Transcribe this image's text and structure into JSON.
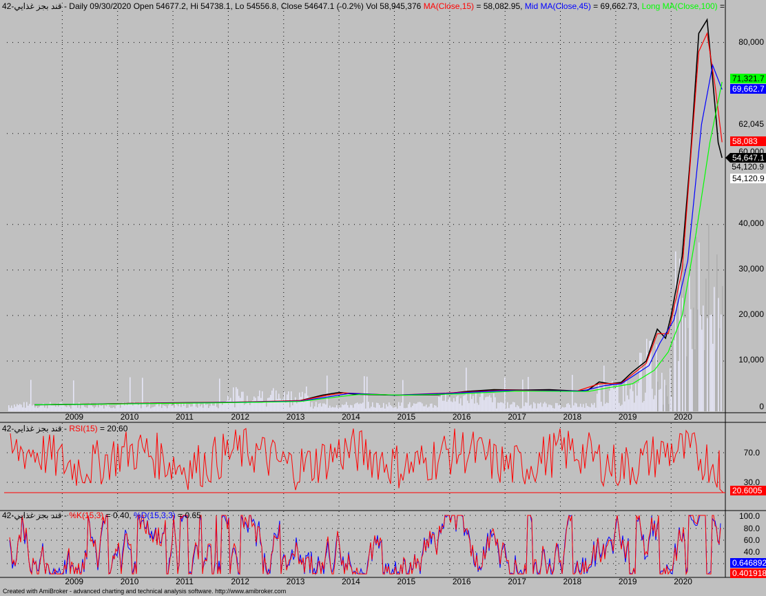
{
  "footer": "Created with AmiBroker - advanced charting and technical analysis software. http://www.amibroker.com",
  "main_pane": {
    "header_prefix": "42-قند بجز غذايي - Daily 09/30/2020 Open 54677.2, Hi 54738.1, Lo 54556.8, Close 54647.1 (-0.2%) Vol 58,945,376",
    "ma15": {
      "label": "MA(Close,15)",
      "value": "= 58,082.95,",
      "color": "#ff0000"
    },
    "ma45": {
      "label": "Mid MA(Close,45)",
      "value": "= 69,662.73,",
      "color": "#0000ff"
    },
    "ma100": {
      "label": "Long MA(Close,100)",
      "value": "=",
      "color": "#00ff00"
    },
    "y_ticks": [
      "80,000",
      "60,000",
      "40,000",
      "30,000",
      "20,000",
      "10,000",
      "0"
    ],
    "extra_labels": [
      "62,045",
      "54,120.9"
    ],
    "markers": [
      {
        "text": "71,321.7",
        "bg": "#00ff00",
        "fg": "#000000"
      },
      {
        "text": "69,662.7",
        "bg": "#0000ff",
        "fg": "#ffffff"
      },
      {
        "text": "58,083",
        "bg": "#ff0000",
        "fg": "#ffffff"
      },
      {
        "text": "54,647.1",
        "bg": "#000000",
        "fg": "#ffffff"
      },
      {
        "text": "54,120.9",
        "bg": "#ffffff",
        "fg": "#000000"
      }
    ]
  },
  "rsi_pane": {
    "header_prefix": "42-قند بجز غذايي -",
    "label": "RSI(15)",
    "value": "= 20.60",
    "color": "#ff0000",
    "y_ticks": [
      "70.0",
      "30.0"
    ],
    "marker": {
      "text": "20.6005",
      "bg": "#ff0000",
      "fg": "#ffffff"
    }
  },
  "stoch_pane": {
    "header_prefix": "42-قند بجز غذايي -",
    "k_label": "%K(15,3)",
    "k_value": "= 0.40,",
    "d_label": "%D(15,3,3)",
    "d_value": "= 0.65",
    "k_color": "#ff0000",
    "d_color": "#0000ff",
    "y_ticks": [
      "100.0",
      "80.0",
      "60.0",
      "40.0",
      "20.0"
    ],
    "markers": [
      {
        "text": "0.646892",
        "bg": "#0000ff",
        "fg": "#ffffff"
      },
      {
        "text": "0.401918",
        "bg": "#ff0000",
        "fg": "#ffffff"
      }
    ]
  },
  "years": [
    "2009",
    "2010",
    "2011",
    "2012",
    "2013",
    "2014",
    "2015",
    "2016",
    "2017",
    "2018",
    "2019",
    "2020"
  ],
  "chart_data": {
    "type": "line",
    "title": "42-قند بجز غذايي - Daily",
    "x": [
      "2009",
      "2010",
      "2011",
      "2012",
      "2013",
      "2014",
      "2015",
      "2016",
      "2017",
      "2018",
      "2019",
      "2020"
    ],
    "ylim": [
      0,
      90000
    ],
    "series": [
      {
        "name": "Close",
        "color": "#000000",
        "points": [
          [
            2008.5,
            400
          ],
          [
            2009.5,
            500
          ],
          [
            2010.3,
            700
          ],
          [
            2011.0,
            800
          ],
          [
            2011.8,
            900
          ],
          [
            2012.6,
            1000
          ],
          [
            2013.3,
            1300
          ],
          [
            2013.7,
            2500
          ],
          [
            2014.0,
            3100
          ],
          [
            2014.3,
            2700
          ],
          [
            2015.0,
            2500
          ],
          [
            2015.8,
            2600
          ],
          [
            2016.3,
            3300
          ],
          [
            2016.8,
            3700
          ],
          [
            2017.3,
            3600
          ],
          [
            2017.8,
            3700
          ],
          [
            2018.3,
            3400
          ],
          [
            2018.5,
            3600
          ],
          [
            2018.7,
            5400
          ],
          [
            2018.9,
            5000
          ],
          [
            2019.1,
            5300
          ],
          [
            2019.3,
            7600
          ],
          [
            2019.55,
            10000
          ],
          [
            2019.75,
            17000
          ],
          [
            2019.9,
            15000
          ],
          [
            2020.0,
            20000
          ],
          [
            2020.2,
            33000
          ],
          [
            2020.35,
            55000
          ],
          [
            2020.5,
            82000
          ],
          [
            2020.65,
            85000
          ],
          [
            2020.75,
            72000
          ],
          [
            2020.85,
            58000
          ],
          [
            2020.92,
            54647
          ]
        ]
      },
      {
        "name": "MA(Close,15)",
        "color": "#ff0000",
        "points": [
          [
            2008.5,
            400
          ],
          [
            2010.3,
            700
          ],
          [
            2011.8,
            900
          ],
          [
            2013.3,
            1300
          ],
          [
            2013.8,
            2500
          ],
          [
            2014.1,
            3000
          ],
          [
            2015.0,
            2500
          ],
          [
            2016.0,
            3000
          ],
          [
            2017.0,
            3600
          ],
          [
            2018.3,
            3400
          ],
          [
            2018.7,
            5000
          ],
          [
            2019.1,
            5100
          ],
          [
            2019.55,
            9500
          ],
          [
            2019.75,
            16000
          ],
          [
            2019.95,
            16000
          ],
          [
            2020.2,
            30000
          ],
          [
            2020.5,
            78000
          ],
          [
            2020.65,
            82000
          ],
          [
            2020.8,
            70000
          ],
          [
            2020.92,
            58083
          ]
        ]
      },
      {
        "name": "Mid MA(Close,45)",
        "color": "#0000ff",
        "points": [
          [
            2008.5,
            400
          ],
          [
            2010.3,
            650
          ],
          [
            2011.8,
            850
          ],
          [
            2013.3,
            1200
          ],
          [
            2013.9,
            2300
          ],
          [
            2014.2,
            2900
          ],
          [
            2015.0,
            2500
          ],
          [
            2016.0,
            2900
          ],
          [
            2017.0,
            3500
          ],
          [
            2018.4,
            3400
          ],
          [
            2018.8,
            4600
          ],
          [
            2019.1,
            5000
          ],
          [
            2019.6,
            9000
          ],
          [
            2019.8,
            14000
          ],
          [
            2020.05,
            19000
          ],
          [
            2020.3,
            32000
          ],
          [
            2020.55,
            62000
          ],
          [
            2020.75,
            75000
          ],
          [
            2020.92,
            69663
          ]
        ]
      },
      {
        "name": "Long MA(Close,100)",
        "color": "#00ff00",
        "points": [
          [
            2008.5,
            400
          ],
          [
            2010.3,
            600
          ],
          [
            2011.8,
            800
          ],
          [
            2013.3,
            1100
          ],
          [
            2014.1,
            2300
          ],
          [
            2014.4,
            2700
          ],
          [
            2015.2,
            2500
          ],
          [
            2016.2,
            2800
          ],
          [
            2017.2,
            3400
          ],
          [
            2018.5,
            3300
          ],
          [
            2018.9,
            4200
          ],
          [
            2019.3,
            5000
          ],
          [
            2019.7,
            8000
          ],
          [
            2019.95,
            12000
          ],
          [
            2020.2,
            20000
          ],
          [
            2020.45,
            38000
          ],
          [
            2020.7,
            58000
          ],
          [
            2020.92,
            71322
          ]
        ]
      }
    ],
    "rsi": {
      "name": "RSI(15)",
      "last": 20.6
    },
    "stochastic": {
      "k_last": 0.4,
      "d_last": 0.65
    }
  }
}
